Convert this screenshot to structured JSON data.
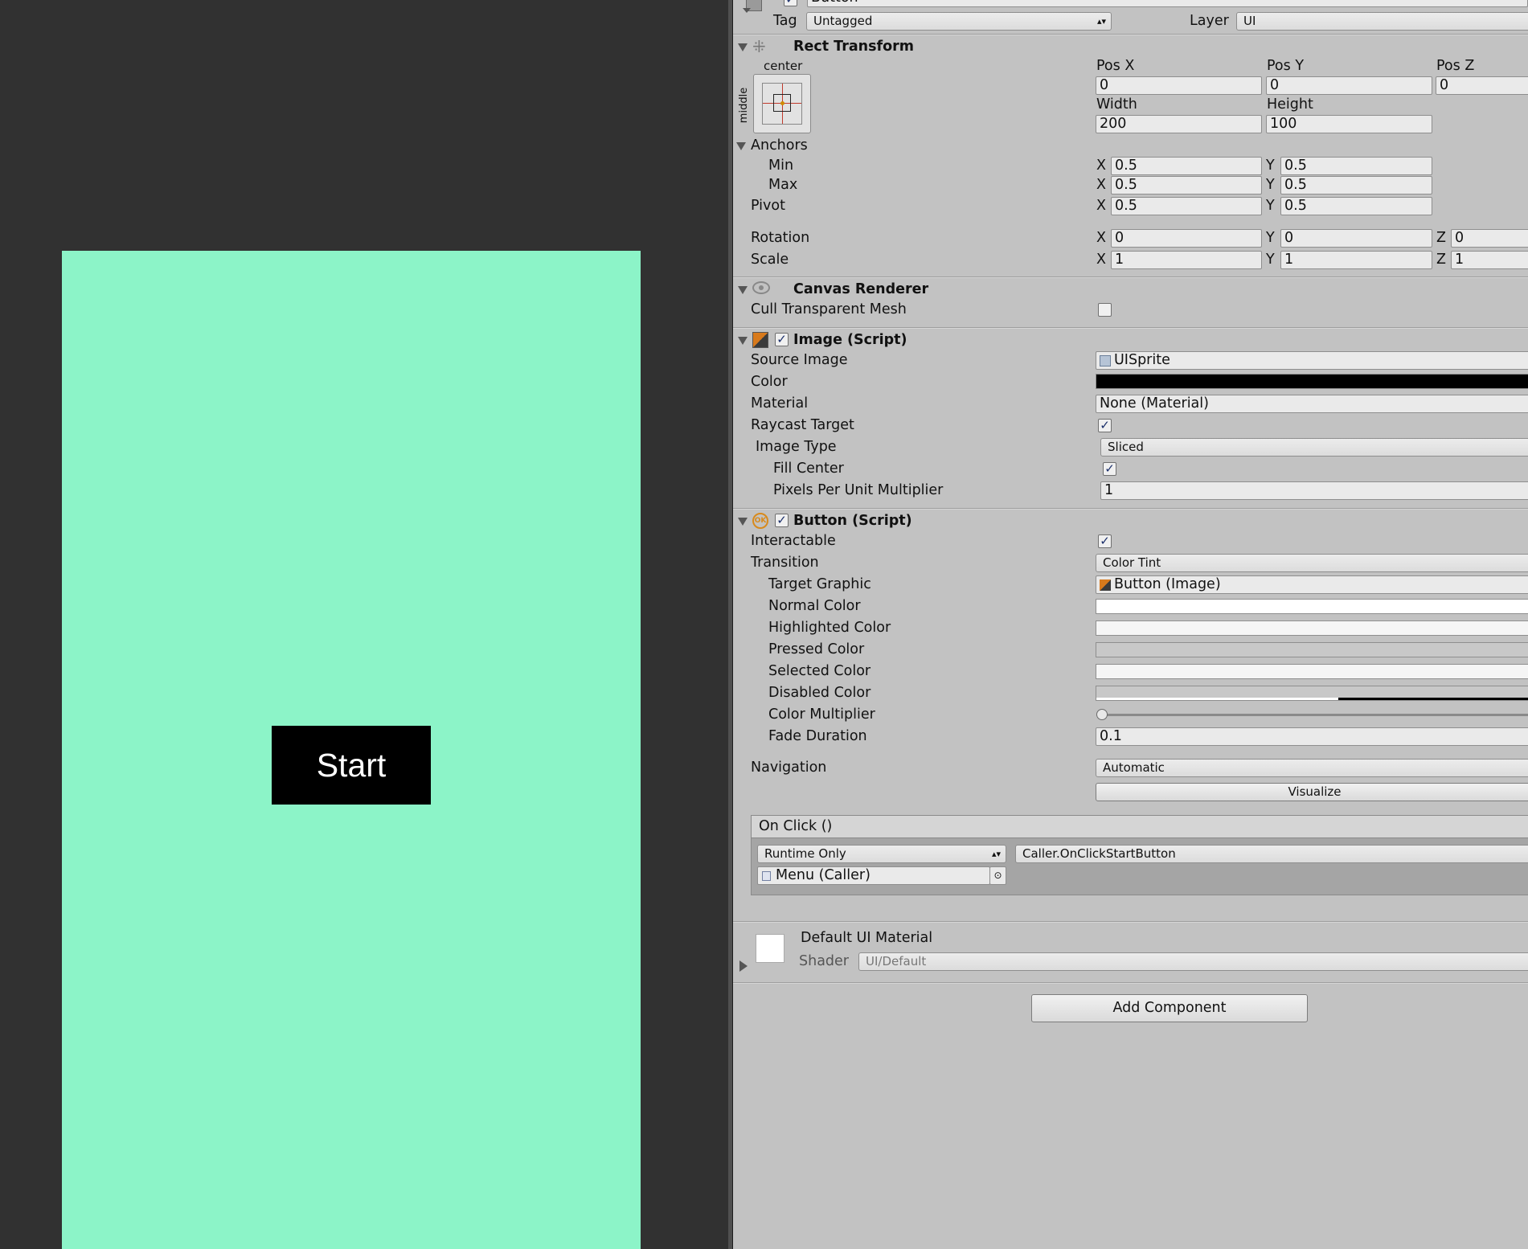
{
  "game_view": {
    "start_button_label": "Start"
  },
  "inspector": {
    "header": {
      "object_name": "Button",
      "tag_label": "Tag",
      "tag_value": "Untagged",
      "layer_label": "Layer",
      "layer_value": "UI"
    },
    "rect_transform": {
      "title": "Rect Transform",
      "anchor_preset_top": "center",
      "anchor_preset_side": "middle",
      "pos_x_label": "Pos X",
      "pos_x": "0",
      "pos_y_label": "Pos Y",
      "pos_y": "0",
      "pos_z_label": "Pos Z",
      "pos_z": "0",
      "width_label": "Width",
      "width": "200",
      "height_label": "Height",
      "height": "100",
      "anchors_label": "Anchors",
      "min_label": "Min",
      "min_x": "0.5",
      "min_y": "0.5",
      "max_label": "Max",
      "max_x": "0.5",
      "max_y": "0.5",
      "pivot_label": "Pivot",
      "pivot_x": "0.5",
      "pivot_y": "0.5",
      "rotation_label": "Rotation",
      "rot_x": "0",
      "rot_y": "0",
      "rot_z": "0",
      "scale_label": "Scale",
      "scale_x": "1",
      "scale_y": "1",
      "scale_z": "1",
      "x_axis": "X",
      "y_axis": "Y",
      "z_axis": "Z"
    },
    "canvas_renderer": {
      "title": "Canvas Renderer",
      "cull_label": "Cull Transparent Mesh"
    },
    "image_script": {
      "title": "Image (Script)",
      "source_image_label": "Source Image",
      "source_image": "UISprite",
      "color_label": "Color",
      "color_value": "#000000",
      "material_label": "Material",
      "material_value": "None (Material)",
      "raycast_label": "Raycast Target",
      "image_type_label": "Image Type",
      "image_type": "Sliced",
      "fill_center_label": "Fill Center",
      "ppu_label": "Pixels Per Unit Multiplier",
      "ppu_value": "1"
    },
    "button_script": {
      "title": "Button (Script)",
      "interactable_label": "Interactable",
      "transition_label": "Transition",
      "transition_value": "Color Tint",
      "target_graphic_label": "Target Graphic",
      "target_graphic_value": "Button (Image)",
      "normal_color_label": "Normal Color",
      "highlighted_color_label": "Highlighted Color",
      "pressed_color_label": "Pressed Color",
      "selected_color_label": "Selected Color",
      "disabled_color_label": "Disabled Color",
      "color_multiplier_label": "Color Multiplier",
      "fade_duration_label": "Fade Duration",
      "fade_duration": "0.1",
      "navigation_label": "Navigation",
      "navigation_value": "Automatic",
      "visualize_label": "Visualize",
      "on_click_label": "On Click ()",
      "runtime_value": "Runtime Only",
      "function_value": "Caller.OnClickStartButton",
      "object_value": "Menu (Caller)"
    },
    "material": {
      "name": "Default UI Material",
      "shader_label": "Shader",
      "shader_value": "UI/Default"
    },
    "add_component_label": "Add Component"
  }
}
